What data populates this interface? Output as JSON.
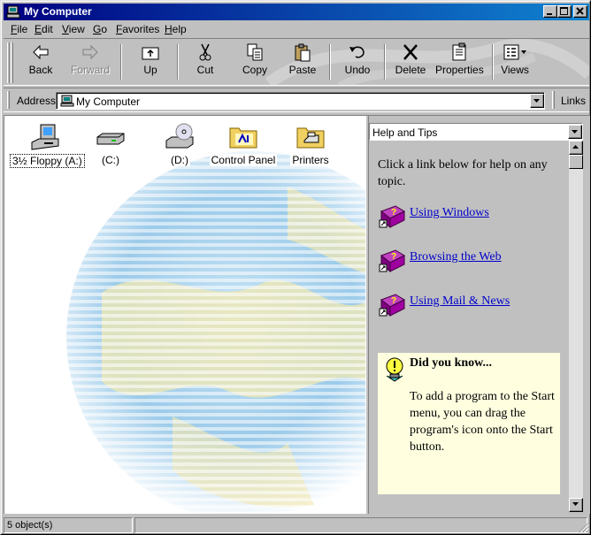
{
  "window": {
    "title": "My Computer",
    "icon": "my-computer-icon"
  },
  "menu": [
    {
      "key": "F",
      "rest": "ile"
    },
    {
      "key": "E",
      "rest": "dit"
    },
    {
      "key": "V",
      "rest": "iew"
    },
    {
      "key": "G",
      "rest": "o"
    },
    {
      "key": "F",
      "rest": "avorites",
      "pre": ""
    },
    {
      "key": "H",
      "rest": "elp"
    }
  ],
  "toolbar": {
    "back": "Back",
    "forward": "Forward",
    "up": "Up",
    "cut": "Cut",
    "copy": "Copy",
    "paste": "Paste",
    "undo": "Undo",
    "delete": "Delete",
    "properties": "Properties",
    "views": "Views"
  },
  "address": {
    "label": "Address",
    "value": "My Computer",
    "links_label": "Links"
  },
  "drives": [
    {
      "label": "3½ Floppy (A:)",
      "icon": "floppy-drive-icon",
      "selected": true
    },
    {
      "label": "(C:)",
      "icon": "hard-drive-icon"
    },
    {
      "label": "(D:)",
      "icon": "cd-drive-icon"
    },
    {
      "label": "Control Panel",
      "icon": "control-panel-icon"
    },
    {
      "label": "Printers",
      "icon": "printers-folder-icon"
    }
  ],
  "help_panel": {
    "select_value": "Help and Tips",
    "intro": "Click a link below for help on any topic.",
    "links": [
      {
        "label": "Using Windows",
        "icon": "help-book-icon"
      },
      {
        "label": "Browsing the Web",
        "icon": "help-book-icon"
      },
      {
        "label": "Using Mail & News",
        "icon": "help-book-icon"
      }
    ],
    "did_you_know_title": "Did you know...",
    "did_you_know_body": "To add a program to the Start menu, you can drag the program's icon onto the Start button."
  },
  "status": {
    "objects": "5 object(s)"
  },
  "colors": {
    "titlebar_start": "#000080",
    "titlebar_end": "#1084d0",
    "link": "#0000cc",
    "tip_background": "#ffffe0"
  }
}
